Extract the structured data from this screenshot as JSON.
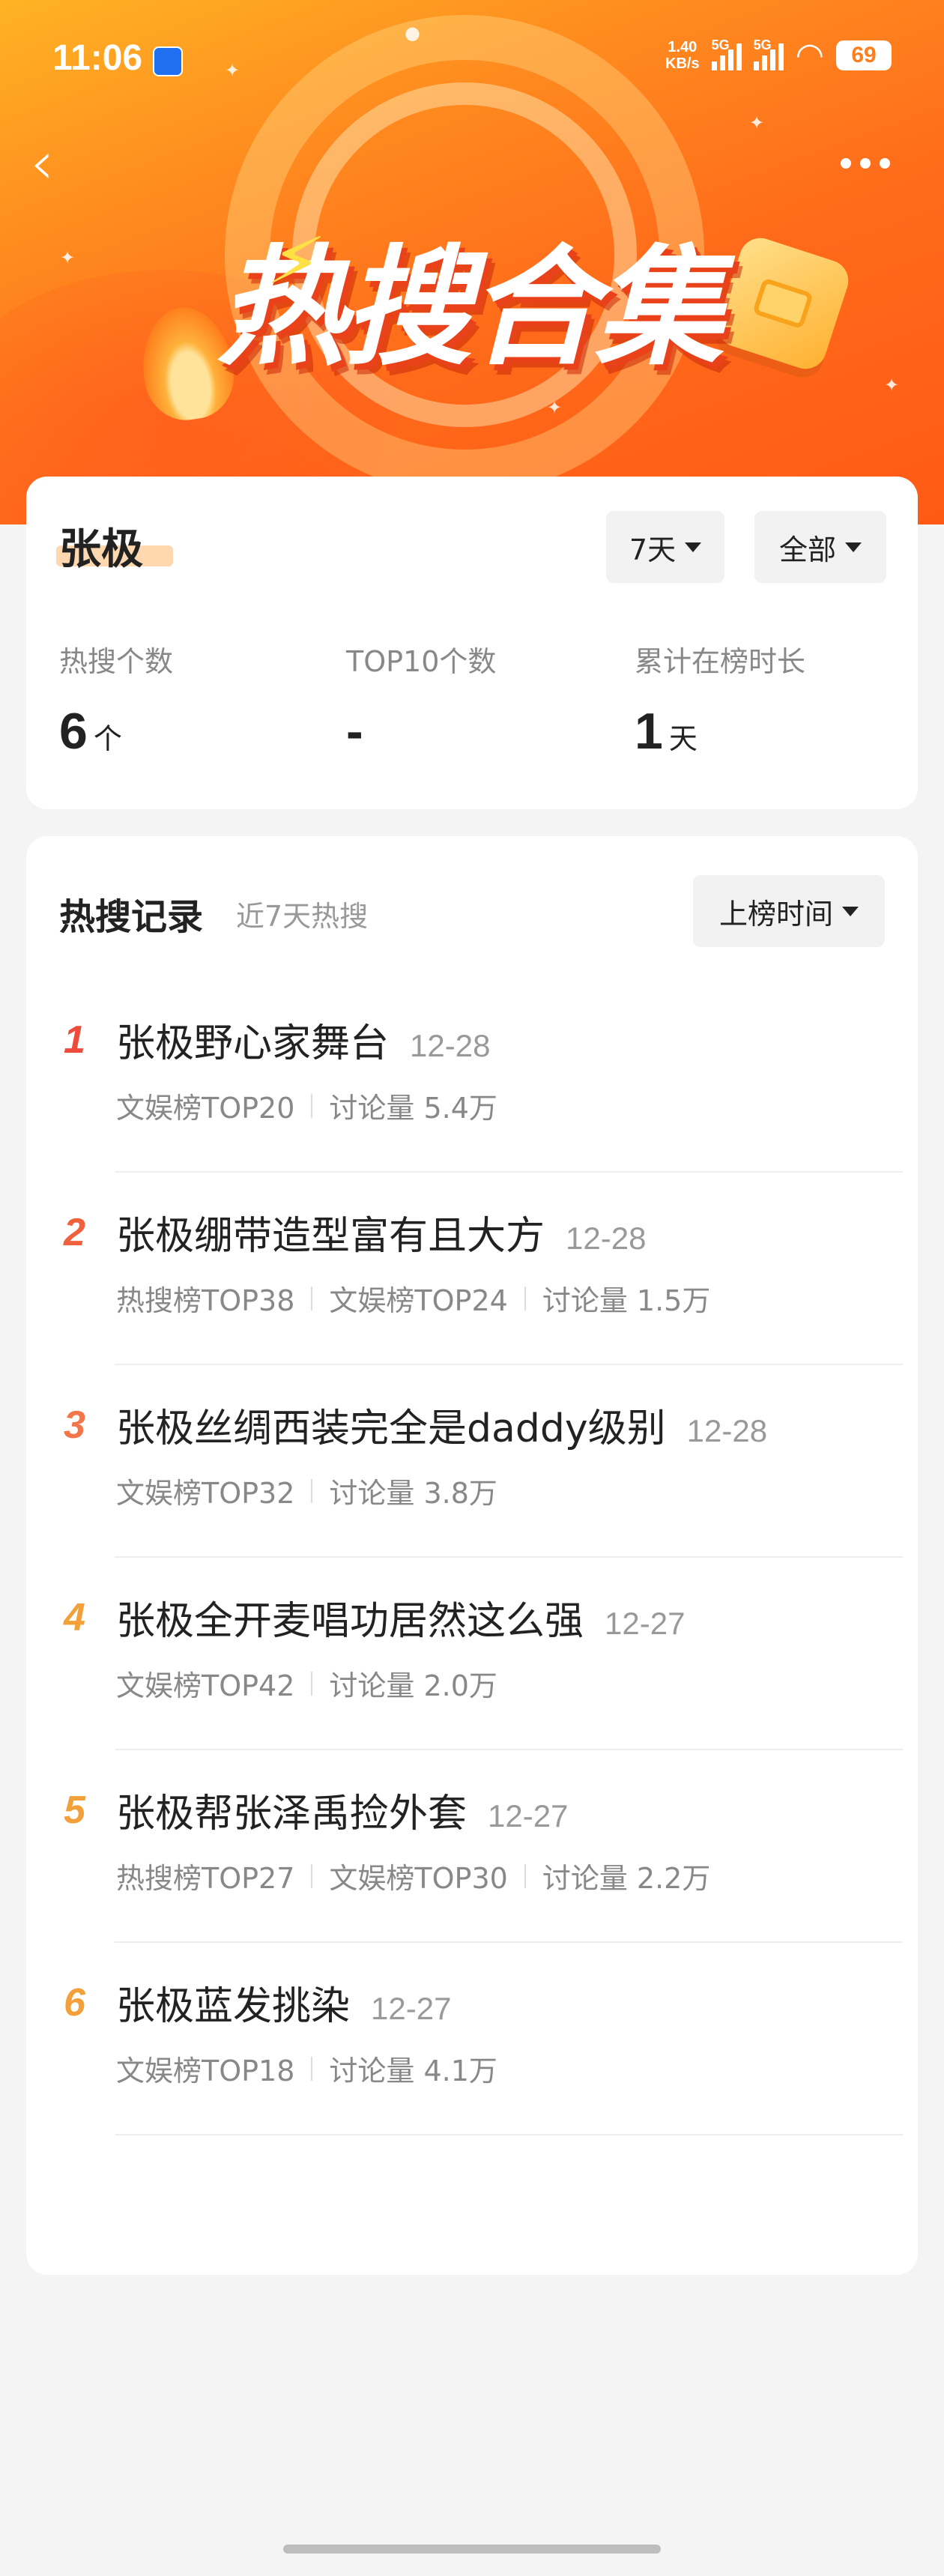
{
  "status_bar": {
    "time": "11:06",
    "net_speed": "1.40",
    "net_unit": "KB/s",
    "sig1": "5G",
    "sig2": "5G",
    "battery": "69"
  },
  "header": {
    "banner_title": "热搜合集"
  },
  "summary": {
    "name": "张极",
    "period_filter": "7天",
    "scope_filter": "全部",
    "stats": [
      {
        "label": "热搜个数",
        "value": "6",
        "unit": "个"
      },
      {
        "label": "TOP10个数",
        "value": "-",
        "unit": ""
      },
      {
        "label": "累计在榜时长",
        "value": "1",
        "unit": "天"
      }
    ]
  },
  "records": {
    "title": "热搜记录",
    "subtitle": "近7天热搜",
    "sort_filter": "上榜时间",
    "items": [
      {
        "rank": "1",
        "rank_color": "#ee4b3b",
        "headline": "张极野心家舞台",
        "date": "12-28",
        "meta": [
          "文娱榜TOP20",
          "讨论量 5.4万"
        ]
      },
      {
        "rank": "2",
        "rank_color": "#f0623e",
        "headline": "张极绷带造型富有且大方",
        "date": "12-28",
        "meta": [
          "热搜榜TOP38",
          "文娱榜TOP24",
          "讨论量 1.5万"
        ]
      },
      {
        "rank": "3",
        "rank_color": "#f2764a",
        "headline": "张极丝绸西装完全是daddy级别",
        "date": "12-28",
        "meta": [
          "文娱榜TOP32",
          "讨论量 3.8万"
        ]
      },
      {
        "rank": "4",
        "rank_color": "#f2a13a",
        "headline": "张极全开麦唱功居然这么强",
        "date": "12-27",
        "meta": [
          "文娱榜TOP42",
          "讨论量 2.0万"
        ]
      },
      {
        "rank": "5",
        "rank_color": "#f2a13a",
        "headline": "张极帮张泽禹捡外套",
        "date": "12-27",
        "meta": [
          "热搜榜TOP27",
          "文娱榜TOP30",
          "讨论量 2.2万"
        ]
      },
      {
        "rank": "6",
        "rank_color": "#f2a13a",
        "headline": "张极蓝发挑染",
        "date": "12-27",
        "meta": [
          "文娱榜TOP18",
          "讨论量 4.1万"
        ]
      }
    ]
  }
}
